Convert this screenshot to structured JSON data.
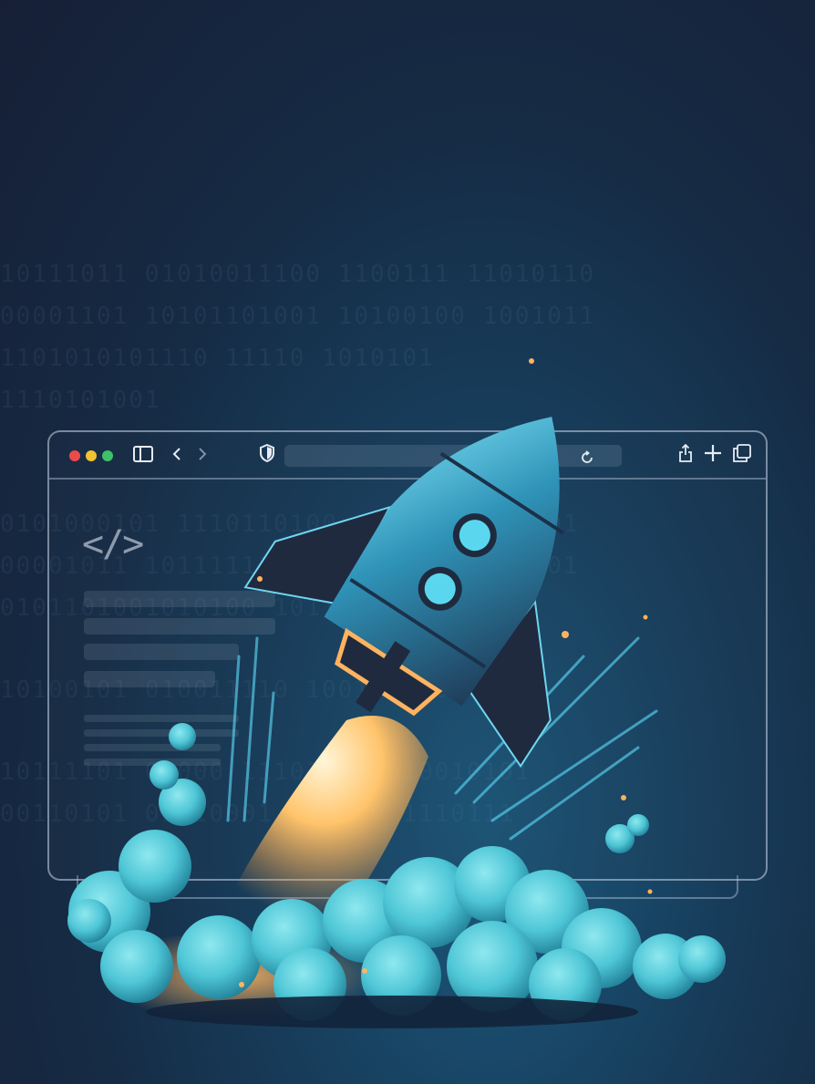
{
  "scene": {
    "subject": "rocket-launch-illustration",
    "colors": {
      "background_top": "#161f36",
      "background_glow": "#1c5a7e",
      "rocket_body": "#2f93b8",
      "rocket_highlight": "#7fe3f7",
      "rocket_dark": "#1f2a3f",
      "flame": "#ffc46b",
      "cloud": "#4ec6d6"
    }
  },
  "browser": {
    "traffic_lights": [
      "#ec4b4b",
      "#f2c230",
      "#3fc168"
    ],
    "icons": [
      "sidebar-icon",
      "back-icon",
      "forward-icon",
      "shield-icon",
      "reload-icon",
      "share-icon",
      "new-tab-icon",
      "tabs-icon"
    ],
    "code_symbol": "</>"
  },
  "binary": [
    "10111011 01010011100 1100111 11010110",
    "00001101 10101101001 10100100 1001011",
    "1101010101110        11110  1010101",
    "    1110101001",
    "0101000101 1110110100 11010100110101",
    "00001011 10111111101 001100010111001",
    "0101101001010100 1011110100010111",
    "10100101 010011110 1001010101001",
    "10111101 01000 11101100 010010101",
    "00110101 01010001 110000 1110111"
  ]
}
